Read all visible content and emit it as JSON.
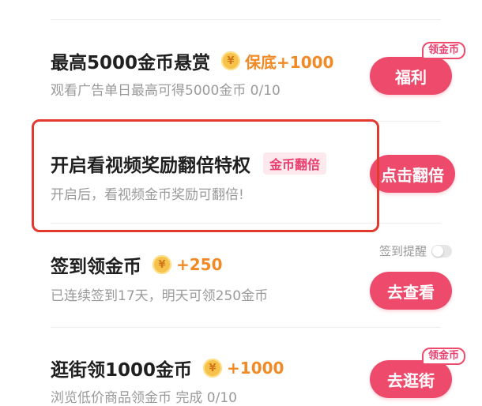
{
  "tasks": [
    {
      "title": "最高5000金币悬赏",
      "coin_symbol": "¥",
      "reward": "保底+1000",
      "desc": "观看广告单日最高可得5000金币 0/10",
      "button": "福利",
      "badge": "领金币"
    },
    {
      "title": "开启看视频奖励翻倍特权",
      "tag": "金币翻倍",
      "desc": "开启后，看视频金币奖励可翻倍!",
      "button": "点击翻倍"
    },
    {
      "title": "签到领金币",
      "coin_symbol": "¥",
      "reward": "+250",
      "desc": "已连续签到17天，明天可领250金币",
      "button": "去查看",
      "reminder_label": "签到提醒",
      "reminder_on": false
    },
    {
      "title": "逛街领1000金币",
      "coin_symbol": "¥",
      "reward": "+1000",
      "desc": "浏览低价商品领金币 完成 0/10",
      "button": "去逛街",
      "badge": "领金币"
    }
  ],
  "colors": {
    "accent": "#ee4a6b",
    "reward": "#f08a26",
    "highlight_border": "#e23a2e"
  }
}
